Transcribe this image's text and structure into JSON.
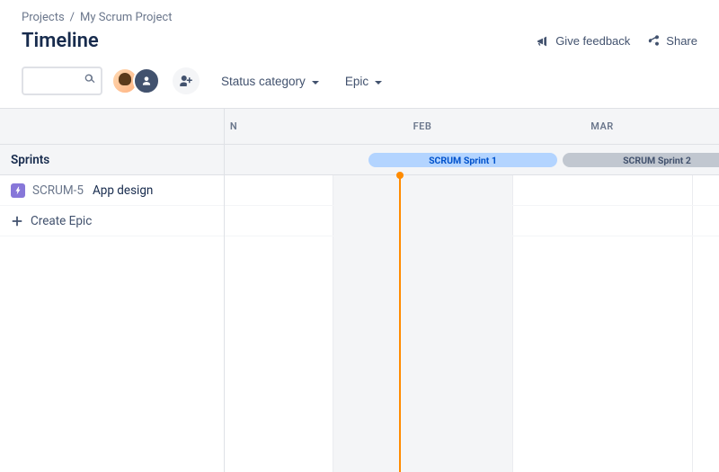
{
  "breadcrumb": {
    "root": "Projects",
    "project": "My Scrum Project",
    "sep": "/"
  },
  "page_title": "Timeline",
  "actions": {
    "feedback": "Give feedback",
    "share": "Share"
  },
  "toolbar": {
    "search_placeholder": "",
    "status_label": "Status category",
    "epic_label": "Epic"
  },
  "timeline": {
    "months": [
      "N",
      "FEB",
      "MAR"
    ],
    "sidebar_heading": "Sprints",
    "sprints": [
      {
        "name": "SCRUM Sprint 1",
        "status": "active"
      },
      {
        "name": "SCRUM Sprint 2",
        "status": "inactive"
      }
    ],
    "epics": [
      {
        "key": "SCRUM-5",
        "summary": "App design"
      }
    ],
    "create_label": "Create Epic"
  }
}
